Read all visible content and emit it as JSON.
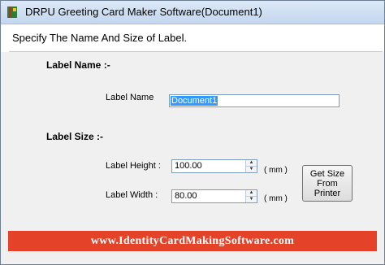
{
  "window": {
    "title": "DRPU Greeting Card Maker Software(Document1)",
    "icon": "app-icon"
  },
  "header": {
    "text": "Specify The Name And Size of Label."
  },
  "label_name_section": {
    "heading": "Label Name :-",
    "field_label": "Label Name",
    "field_value": "Document1"
  },
  "label_size_section": {
    "heading": "Label Size :-",
    "height_label": "Label Height :",
    "height_value": "100.00",
    "height_unit": "( mm )",
    "width_label": "Label Width :",
    "width_value": "80.00",
    "width_unit": "( mm )",
    "get_size_button": "Get Size From Printer"
  },
  "footer": {
    "text": "www.IdentityCardMakingSoftware.com",
    "color": "#e5422a"
  }
}
